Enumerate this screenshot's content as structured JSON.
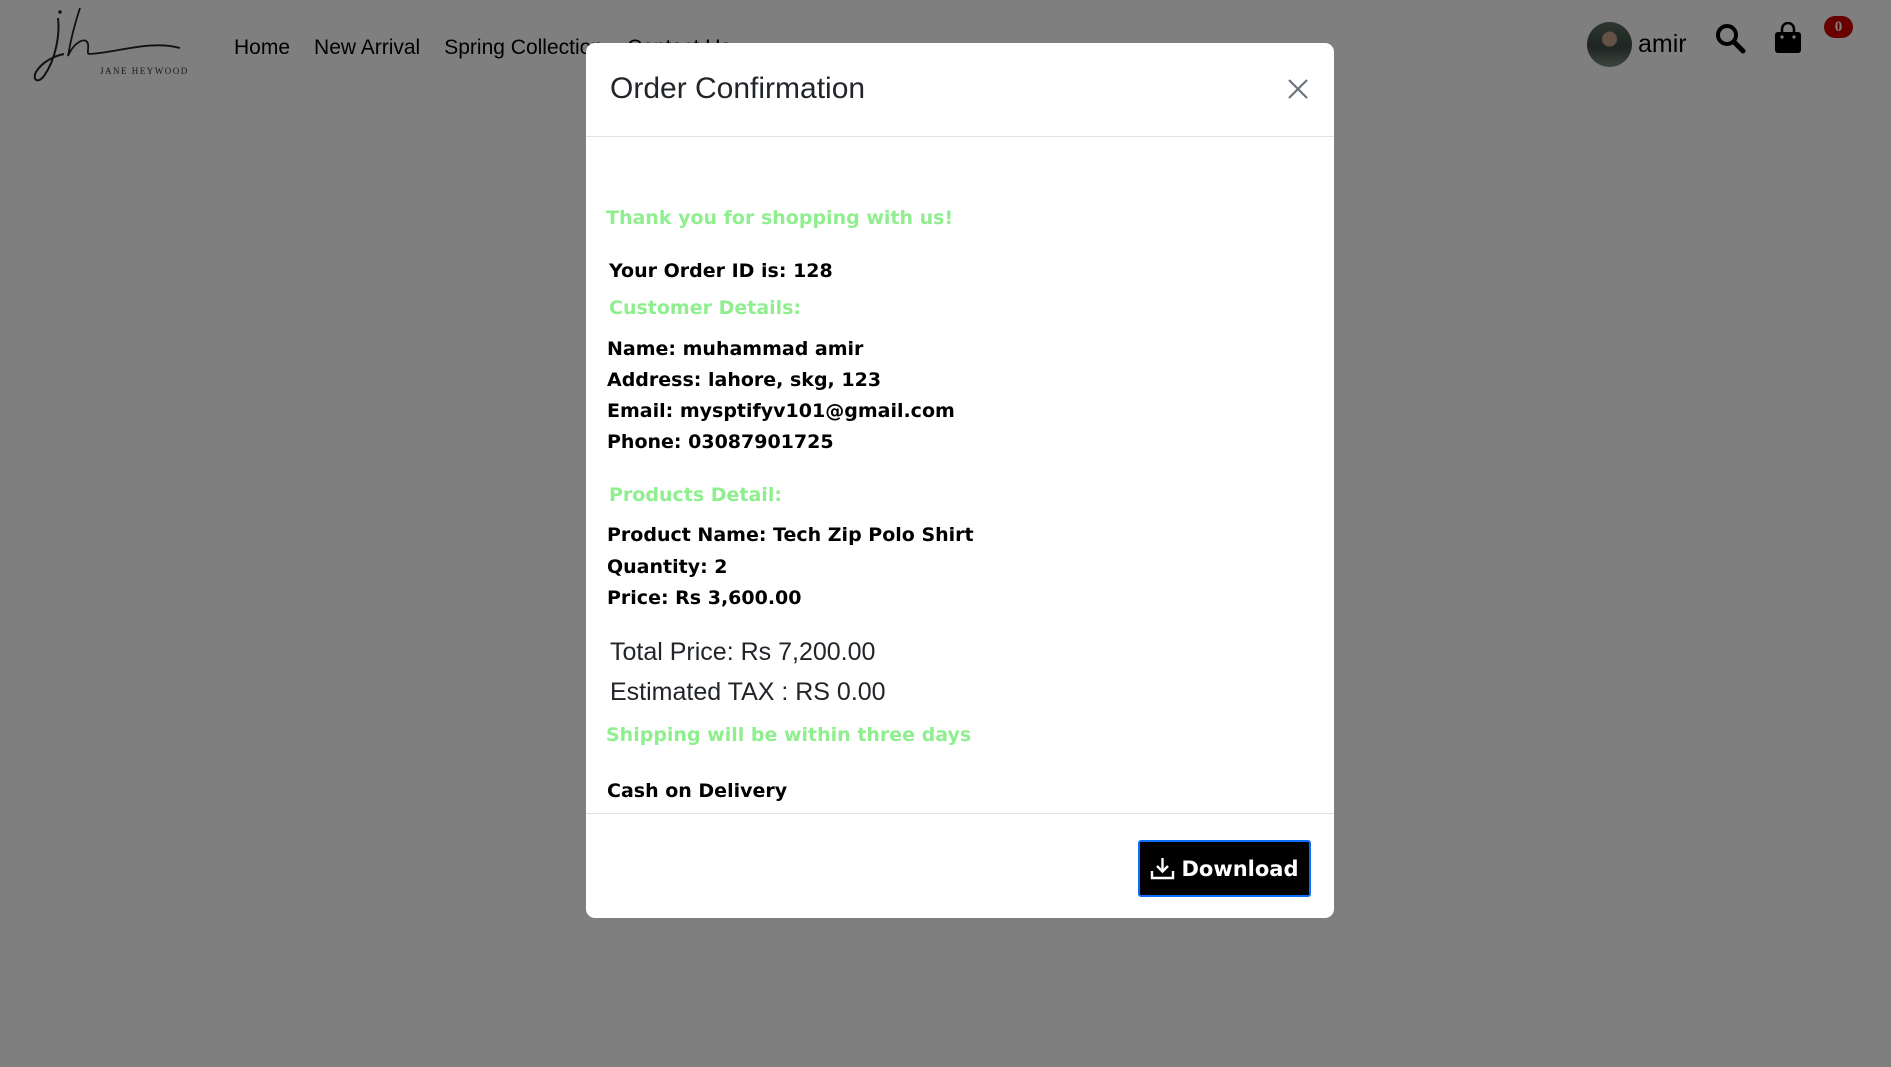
{
  "header": {
    "logo_tag": "JANE HEYWOOD",
    "nav": [
      {
        "label": "Home"
      },
      {
        "label": "New Arrival"
      },
      {
        "label": "Spring Collection"
      },
      {
        "label": "Contact Us"
      }
    ],
    "user_name": "amir",
    "cart_count": "0"
  },
  "modal": {
    "title": "Order Confirmation",
    "thank_you": "Thank you for shopping with us!",
    "order_id": "Your Order ID is: 128",
    "customer_heading": "Customer Details:",
    "customer": {
      "name": "Name: muhammad amir",
      "address": "Address: lahore, skg, 123",
      "email": "Email: mysptifyv101@gmail.com",
      "phone": "Phone: 03087901725"
    },
    "products_heading": "Products Detail:",
    "product": {
      "name": "Product Name: Tech Zip Polo Shirt",
      "quantity": "Quantity: 2",
      "price": "Price: Rs 3,600.00"
    },
    "total_price": "Total Price: Rs 7,200.00",
    "estimated_tax": "Estimated TAX : RS 0.00",
    "shipping_note": "Shipping will be within three days",
    "payment_method": "Cash on Delivery",
    "download_label": "Download"
  },
  "colors": {
    "accent_green": "#8fef8f",
    "button_bg": "#000000",
    "button_border": "#0d6efd",
    "badge": "#d00000"
  }
}
